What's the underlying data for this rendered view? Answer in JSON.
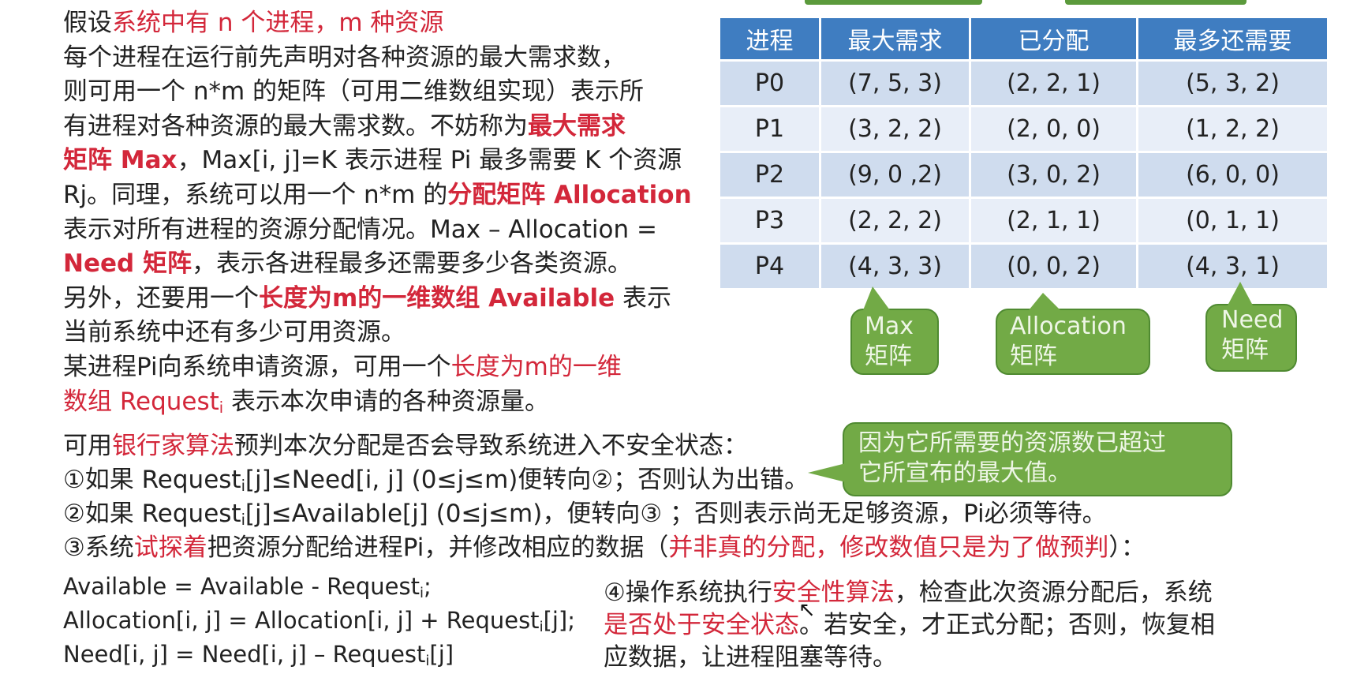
{
  "para": {
    "l1": [
      "假设",
      "系统中有 n 个进程，m 种资源"
    ],
    "l2": "每个进程在运行前先声明对各种资源的最大需求数，",
    "l3": "则可用一个 n*m 的矩阵（可用二维数组实现）表示所",
    "l4": [
      "有进程对各种资源的最大需求数。不妨称为",
      "最大需求"
    ],
    "l5": [
      "矩阵 Max",
      "，Max[i, j]=K 表示进程 Pi 最多需要 K 个资源"
    ],
    "l6": [
      "Rj。同理，系统可以用一个 n*m 的",
      "分配矩阵 Allocation"
    ],
    "l7": "表示对所有进程的资源分配情况。Max – Allocation =",
    "l8": [
      "Need 矩阵",
      "，表示各进程最多还需要多少各类资源。"
    ],
    "l9": [
      "另外，还要用一个",
      "长度为m的一维数组 Available",
      " 表示"
    ],
    "l10": "当前系统中还有多少可用资源。",
    "l11": [
      "某进程Pi向系统申请资源，可用一个",
      "长度为m的一维"
    ],
    "l12": [
      "数组 Request",
      "i",
      " 表示本次申请的各种资源量。"
    ]
  },
  "table": {
    "headers": [
      "进程",
      "最大需求",
      "已分配",
      "最多还需要"
    ],
    "rows": [
      [
        "P0",
        "(7, 5, 3)",
        "(2, 2, 1)",
        "(5, 3, 2)"
      ],
      [
        "P1",
        "(3, 2, 2)",
        "(2, 0, 0)",
        "(1, 2, 2)"
      ],
      [
        "P2",
        "(9, 0 ,2)",
        "(3, 0, 2)",
        "(6, 0, 0)"
      ],
      [
        "P3",
        "(2, 2, 2)",
        "(2, 1, 1)",
        "(0, 1, 1)"
      ],
      [
        "P4",
        "(4, 3, 3)",
        "(0, 0, 2)",
        "(4, 3, 1)"
      ]
    ]
  },
  "callouts": {
    "max": [
      "Max",
      "矩阵"
    ],
    "alloc": [
      "Allocation",
      "矩阵"
    ],
    "need": [
      "Need",
      "矩阵"
    ],
    "note": [
      "因为它所需要的资源数已超过",
      "它所宣布的最大值。"
    ]
  },
  "steps": {
    "s0": [
      "可用",
      "银行家算法",
      "预判本次分配是否会导致系统进入不安全状态："
    ],
    "s1": [
      "①如果 Request",
      "i",
      "[j]≤Need[i, j] (0≤j≤m)便转向②；否则认为出错。"
    ],
    "s2": [
      "②如果 Request",
      "i",
      "[j]≤Available[j] (0≤j≤m)，便转向③ ；否则表示尚无足够资源，Pi必须等待。"
    ],
    "s3": [
      "③系统",
      "试探着",
      "把资源分配给进程Pi，并修改相应的数据（",
      "并非真的分配，修改数值只是为了做预判",
      "）："
    ]
  },
  "formulas": {
    "f1": [
      "Available = Available - Request",
      "i",
      ";"
    ],
    "f2": [
      "Allocation[i, j] = Allocation[i, j] + Request",
      "i",
      "[j];"
    ],
    "f3": [
      "Need[i, j] = Need[i, j] – Request",
      "i",
      "[j]"
    ]
  },
  "step4": {
    "l1": [
      "④操作系统执行",
      "安全性算法",
      "，检查此次资源分配后，系统"
    ],
    "l2": [
      "是否处于安全状态",
      "。若安全，才正式分配；否则，恢复相"
    ],
    "l3": "应数据，让进程阻塞等待。"
  },
  "colors": {
    "red": "#d3273a",
    "table_header": "#3f7dc1",
    "callout_green": "#72aa46"
  }
}
